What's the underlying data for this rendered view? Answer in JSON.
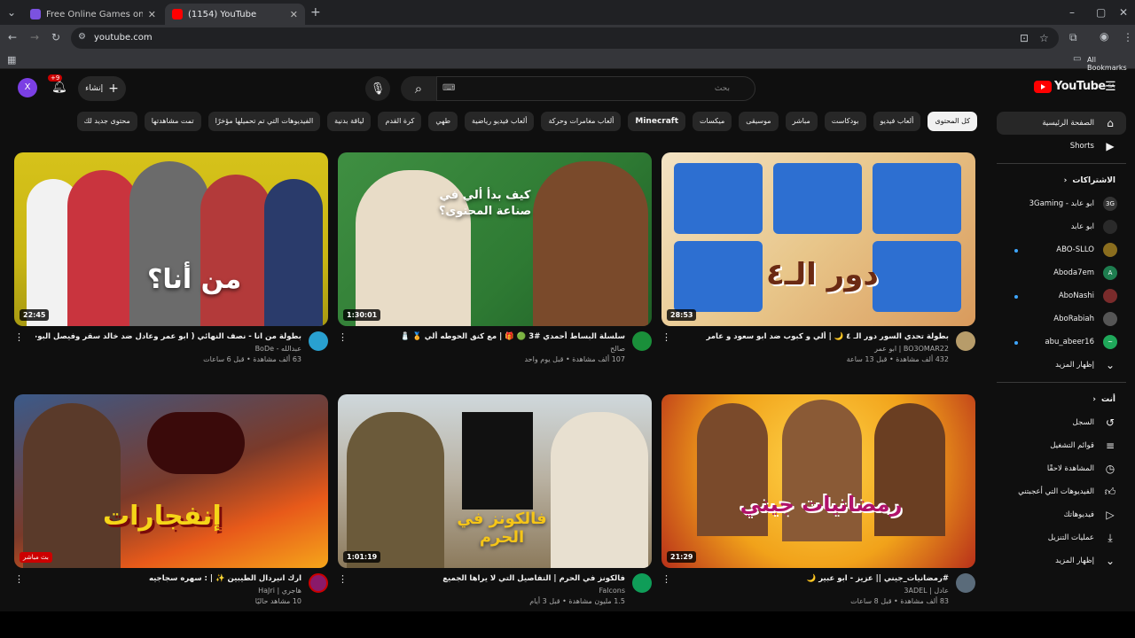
{
  "browser": {
    "tabs": [
      {
        "title": "Free Online Games on CrazyGa",
        "active": false
      },
      {
        "title": "(1154) YouTube",
        "active": true
      }
    ],
    "url": "youtube.com",
    "bookmarks_label": "All Bookmarks"
  },
  "masthead": {
    "search_placeholder": "بحث",
    "create_label": "إنشاء",
    "notif_count": "+9",
    "avatar_letter": "X",
    "logo_text": "YouTube",
    "logo_region": "SA"
  },
  "chips": [
    "كل المحتوى",
    "ألعاب فيديو",
    "بودكاست",
    "مباشر",
    "موسيقى",
    "ميكسات",
    "Minecraft",
    "ألعاب مغامرات وحركة",
    "ألعاب فيديو رياضية",
    "طهي",
    "كرة القدم",
    "لياقة بدنية",
    "الفيديوهات التي تم تحميلها مؤخرًا",
    "تمت مشاهدتها",
    "محتوى جديد لك"
  ],
  "videos": [
    {
      "title": "بطولة تحدي السور دور الـ ٤ 🌙 | ألي و كبوب ضد ابو سعود و عامر",
      "channel": "BO3OMAR22 | ابو عمر",
      "stats": "432 ألف مشاهدة • قبل 13 ساعة",
      "duration": "28:53",
      "overlay": "دور الـ٤"
    },
    {
      "title": "سلسلة البساط أحمدي #3 🟢 🎁 | مع كنق الحوطه ألي 🏅 🧂",
      "channel": "صالح",
      "stats": "107 ألف مشاهدة • قبل يوم واحد",
      "duration": "1:30:01",
      "overlay": "كيف بدأ ألي في صناعة المحتوى؟"
    },
    {
      "title": "بطولة من انا - نصف النهائي ( ابو عمر وعادل ضد خالد سقر وفيصل البوخي )",
      "channel": "عبدالله - BoDe",
      "stats": "63 ألف مشاهدة • قبل 6 ساعات",
      "duration": "22:45",
      "overlay": "من أنا؟"
    },
    {
      "title": "#رمضانيات_جيني || عزيز - ابو عبير 🌙",
      "channel": "عادل | 3ADEL",
      "stats": "83 ألف مشاهدة • قبل 8 ساعات",
      "duration": "21:29",
      "overlay": "رمضانيات جيني"
    },
    {
      "title": "فالكونز في الحرم | التفاصيل التي لا يراها الجميع",
      "channel": "Falcons",
      "stats": "1.5 مليون مشاهدة • قبل 3 أيام",
      "duration": "1:01:19",
      "overlay": "فالكونز في الحرم"
    },
    {
      "title": "ارك انيردال الطيبين ✨ | : سهره سجاجيه",
      "channel": "هاجري | HaJri",
      "stats": "10 مشاهد حاليًا",
      "duration": "بث مباشر",
      "overlay": "إنفجارات"
    }
  ],
  "sidebar": {
    "main": [
      {
        "label": "الصفحة الرئيسية",
        "icon": "home-icon"
      },
      {
        "label": "Shorts",
        "icon": "shorts-icon"
      }
    ],
    "subs_header": "الاشتراكات",
    "subs": [
      {
        "label": "ابو عابد - 3Gaming",
        "color": "#333333",
        "dot": false
      },
      {
        "label": "ابو عابد",
        "color": "#2a2a2a",
        "dot": false
      },
      {
        "label": "ABO-SLLO",
        "color": "#8a6d1e",
        "dot": true
      },
      {
        "label": "Aboda7em",
        "color": "#1e7d4f",
        "dot": false
      },
      {
        "label": "AboNashi",
        "color": "#7a2b2b",
        "dot": true
      },
      {
        "label": "AboRabiah",
        "color": "#555555",
        "dot": false
      },
      {
        "label": "abu_abeer16",
        "color": "#1fa85a",
        "dot": true
      }
    ],
    "show_more": "إظهار المزيد",
    "you_header": "أنت",
    "you": [
      {
        "label": "السجل",
        "icon": "history-icon"
      },
      {
        "label": "قوائم التشغيل",
        "icon": "playlist-icon"
      },
      {
        "label": "المشاهدة لاحقًا",
        "icon": "clock-icon"
      },
      {
        "label": "الفيديوهات التي أعجبتني",
        "icon": "thumbs-up-icon"
      },
      {
        "label": "فيديوهاتك",
        "icon": "video-icon"
      },
      {
        "label": "عمليات التنزيل",
        "icon": "download-icon"
      }
    ],
    "show_more_2": "إظهار المزيد"
  }
}
